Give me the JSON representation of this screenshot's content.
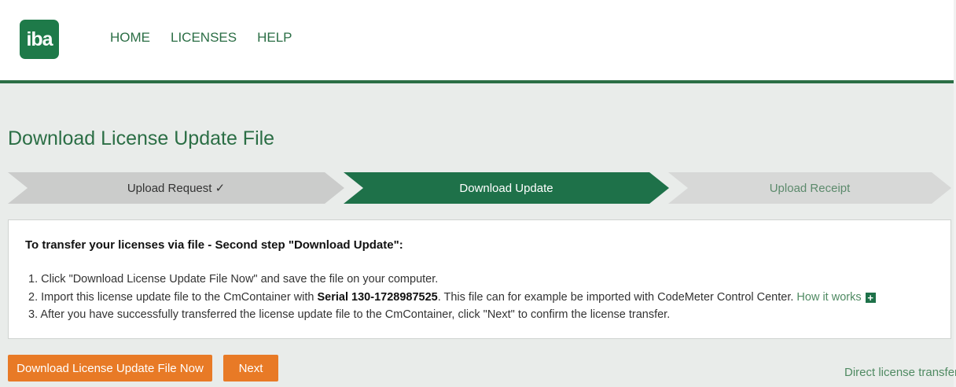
{
  "header": {
    "logo_text": "iba",
    "nav": [
      "HOME",
      "LICENSES",
      "HELP"
    ]
  },
  "page_title": "Download License Update File",
  "steps": [
    {
      "label": "Upload Request ✓",
      "state": "done"
    },
    {
      "label": "Download Update",
      "state": "active"
    },
    {
      "label": "Upload Receipt",
      "state": "pending"
    }
  ],
  "info": {
    "title": "To transfer your licenses via file - Second step \"Download Update\":",
    "item1": "1. Click \"Download License Update File Now\" and save the file on your computer.",
    "item2_pre": "2. Import this license update file to the CmContainer with ",
    "item2_serial": "Serial 130-1728987525",
    "item2_post": ". This file can for example be imported with CodeMeter Control Center. ",
    "item2_link": "How it works",
    "item3": "3. After you have successfully transferred the license update file to the CmContainer, click \"Next\" to confirm the license transfer."
  },
  "buttons": {
    "download": "Download License Update File Now",
    "next": "Next"
  },
  "direct_link": "Direct license transfer",
  "colors": {
    "brand_green": "#1e7149",
    "accent_orange": "#e87a26"
  }
}
